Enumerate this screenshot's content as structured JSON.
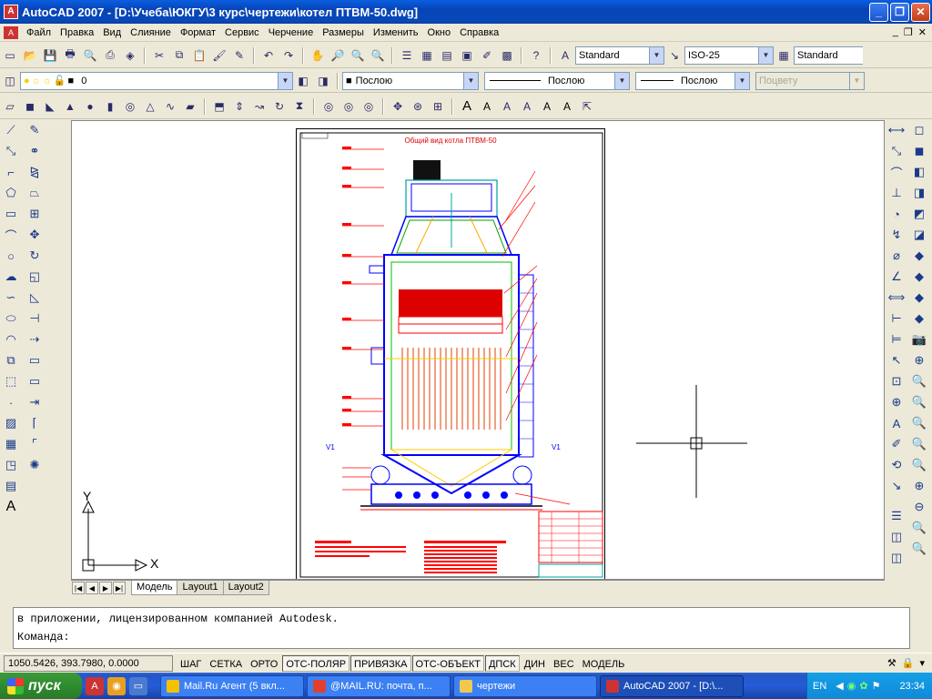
{
  "window": {
    "title": "AutoCAD 2007 - [D:\\Учеба\\ЮКГУ\\3 курс\\чертежи\\котел ПТВМ-50.dwg]"
  },
  "menu": {
    "items": [
      "Файл",
      "Правка",
      "Вид",
      "Слияние",
      "Формат",
      "Сервис",
      "Черчение",
      "Размеры",
      "Изменить",
      "Окно",
      "Справка"
    ]
  },
  "styles_toolbar": {
    "text_style": "Standard",
    "dim_style": "ISO-25",
    "table_style": "Standard"
  },
  "layers_toolbar": {
    "current_layer": "0",
    "color": "Послою",
    "linetype": "Послою",
    "lineweight": "Послою",
    "plot_style": "Поцвету"
  },
  "drawing": {
    "sheet_title": "Общий вид котла ПТВМ-50",
    "ucs_x": "X",
    "ucs_y": "Y"
  },
  "layout_tabs": [
    "Модель",
    "Layout1",
    "Layout2"
  ],
  "command_line": {
    "history": "в приложении, лицензированном компанией Autodesk.",
    "prompt": "Команда:"
  },
  "status": {
    "coordinates": "1050.5426, 393.7980, 0.0000",
    "toggles": [
      "ШАГ",
      "СЕТКА",
      "ОРТО",
      "ОТС-ПОЛЯР",
      "ПРИВЯЗКА",
      "ОТС-ОБЪЕКТ",
      "ДПСК",
      "ДИН",
      "ВЕС",
      "МОДЕЛЬ"
    ]
  },
  "taskbar": {
    "start_label": "пуск",
    "tasks": [
      "Mail.Ru Агент (5 вкл...",
      "@MAIL.RU: почта, п...",
      "чертежи",
      "AutoCAD 2007 - [D:\\..."
    ],
    "language": "EN",
    "clock": "23:34"
  },
  "colors": {
    "drawing_red": "#ff0000",
    "drawing_blue": "#0000ff",
    "drawing_green": "#00c000",
    "drawing_cyan": "#00c0c0"
  }
}
